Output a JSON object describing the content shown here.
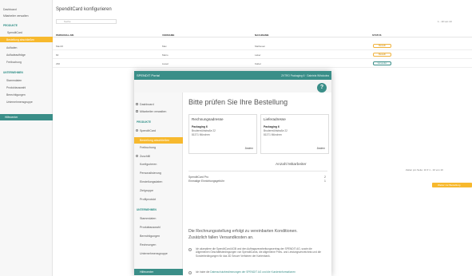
{
  "background": {
    "title": "SpenditCard konfigurieren",
    "search_placeholder": "Suche",
    "sidebar": {
      "items_top": [
        "Dashboard",
        "Mitarbeiter verwalten"
      ],
      "section_products": "PRODUKTE",
      "spenditcard": "SpenditCard",
      "active": "Bestellung abschließen",
      "items_products": [
        "Aufladen",
        "Aufladeaufträge",
        "Freibuchung"
      ],
      "section_company": "UNTERNEHMEN",
      "items_company": [
        "Stammdaten",
        "Produktauswahl",
        "Berechtigungen",
        "Unternehmensgruppe"
      ],
      "footer": "Hilfecenter"
    },
    "table": {
      "headers": [
        "PERSONAL-NR.",
        "VORNAME",
        "NACHNAME",
        "STATUS"
      ],
      "rows": [
        {
          "nr": "Max16",
          "first": "Max",
          "last": "Mathesen",
          "status": "Bestellt"
        },
        {
          "nr": "60",
          "first": "Mario",
          "last": "Laker",
          "status": "Bestellt"
        },
        {
          "nr": "230",
          "first": "Liesel",
          "last": "Kabel",
          "status": "Versendet"
        }
      ]
    },
    "pager_top": "1 - 10 von 10",
    "pager_bottom": "Zeilen pro Seite: 10 ▾   1 - 10 von 10",
    "orange_button": "Weiter zur Bestellung"
  },
  "window": {
    "brand": "SPENDIT Portal",
    "user": "ZVTRO Packaging 6 · Gabriela Wihokolea",
    "help": "?",
    "sidebar": {
      "items_top": [
        "Dashboard",
        "Mitarbeiter verwalten"
      ],
      "section_products": "PRODUKTE",
      "spenditcard": "SpenditCard",
      "active": "Bestellung abschließen",
      "items_products": [
        "Freibuchung",
        "Zuschlill",
        "Konfigurieren",
        "Personalisierung",
        "Einstellungsdaten",
        "Zielgruppe",
        "Profilprodukt"
      ],
      "section_company": "UNTERNEHMEN",
      "items_company": [
        "Stammdaten",
        "Produktauswahl",
        "Berechtigungen",
        "Rechnungen",
        "Unternehmensgruppe"
      ],
      "footer": "Hilfecenter"
    },
    "main": {
      "title": "Bitte prüfen Sie Ihre Bestellung",
      "billing": {
        "heading": "Rechnungsadresse",
        "name": "Packaging 6",
        "street": "Brudermühlstraße 22",
        "city": "81371 München",
        "edit": "Ändern"
      },
      "delivery": {
        "heading": "Lieferadresse",
        "name": "Packaging 6",
        "street": "Brudermühlstraße 22",
        "city": "81371 München",
        "edit": "Ändern"
      },
      "count_heading": "Anzahl Mitarbeiter",
      "products": [
        {
          "name": "SpenditCard Pro",
          "qty": "2"
        },
        {
          "name": "Einmalige Einrichtungsgebühr",
          "qty": "1"
        }
      ],
      "note_line1": "Die Rechnungsstellung erfolgt zu vereinbarten Konditionen.",
      "note_line2": "Zusätzlich fallen Versandkosten an.",
      "checkbox1": "Ich akzeptiere die SpenditCard AGB und den Auftragsverarbeitungsvertrag der SPENDIT AG, sowie die Allgemeinen Geschäftsbedingungen von SpenditCards, die allgemeine Preis- und Leistungsverzeichnis und die Sonderbedingungen für das 3D Secure Verfahren der Kartenbank.",
      "checkbox2_pre": "Ich habe die",
      "checkbox2_link": "Datenschutzbestimmungen der SPENDIT AG und die Kundeninformationen"
    }
  }
}
